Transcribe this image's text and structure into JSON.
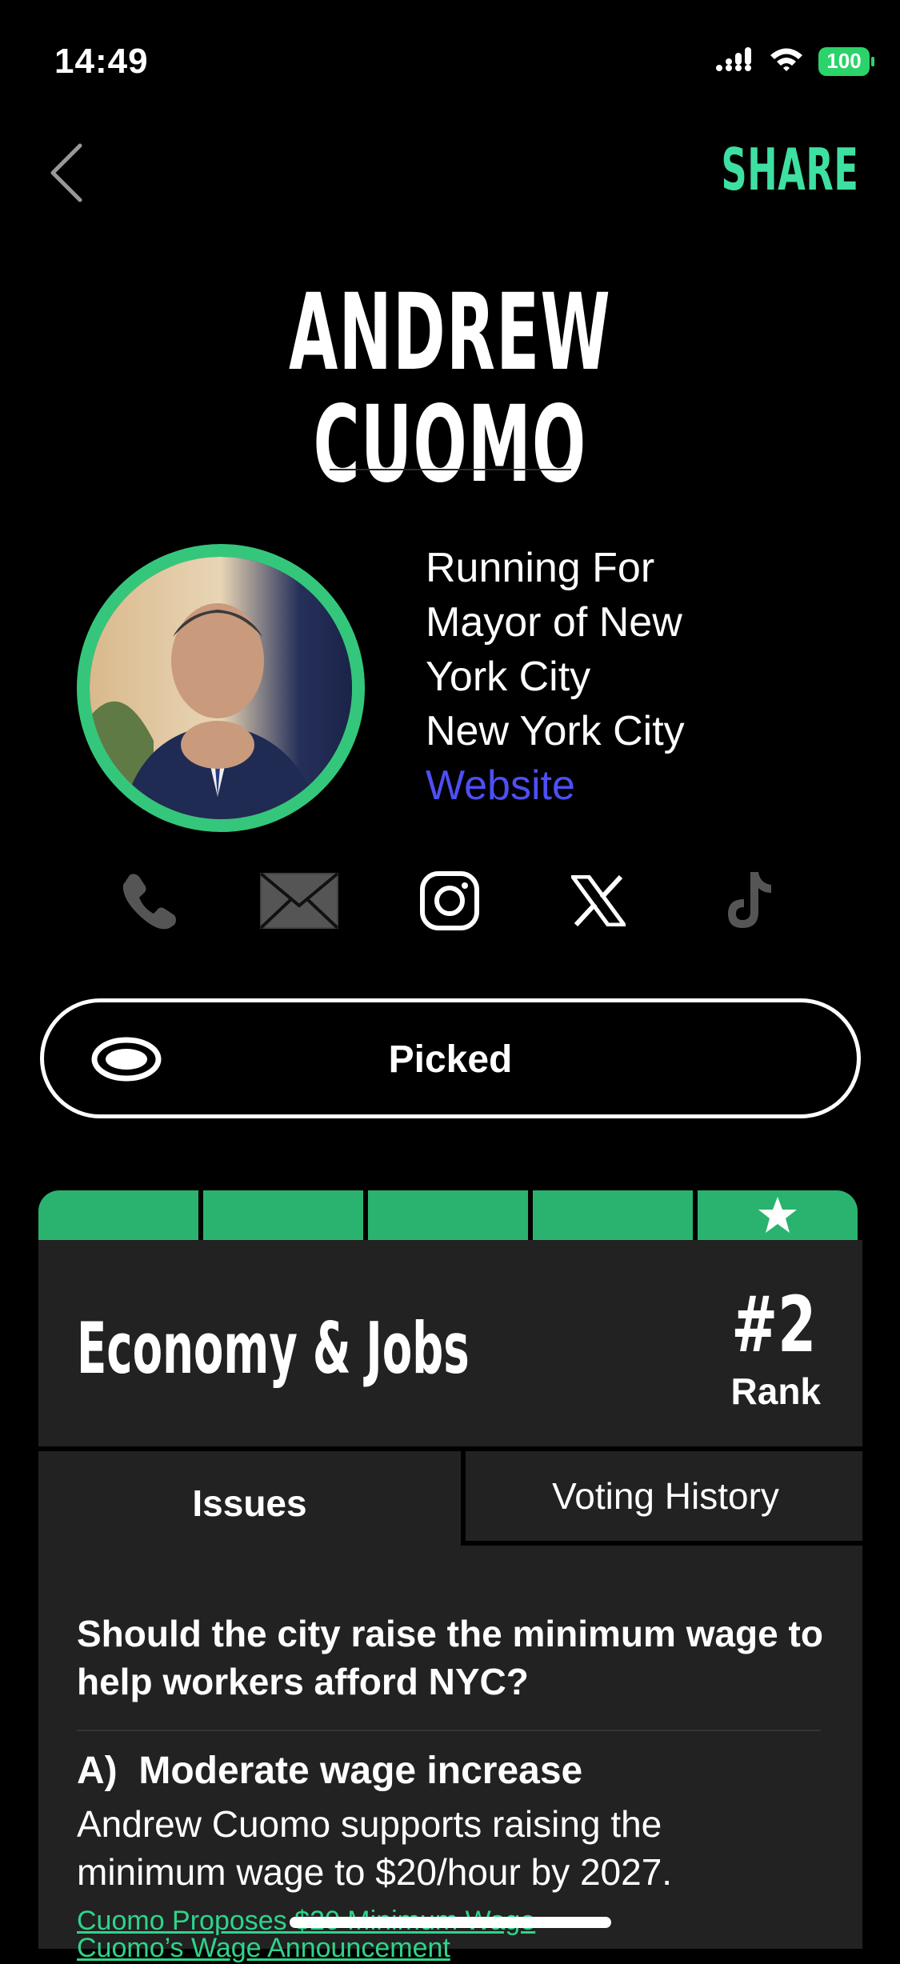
{
  "status_bar": {
    "time": "14:49",
    "battery": "100",
    "icons": [
      "signal-icon",
      "wifi-icon",
      "battery-icon"
    ]
  },
  "header": {
    "back_icon": "chevron-left-icon",
    "share_label": "SHARE",
    "accent_color": "#3ee0a1"
  },
  "candidate": {
    "name": "ANDREW CUOMO",
    "running_for_lines": [
      "Running For",
      "Mayor of New",
      "York City"
    ],
    "location": "New York City",
    "website_label": "Website",
    "ring_color": "#34c77b"
  },
  "social": [
    "phone-icon",
    "mail-icon",
    "instagram-icon",
    "x-icon",
    "tiktok-icon"
  ],
  "pick": {
    "label": "Picked"
  },
  "rating": {
    "segments": 5,
    "star_segment": 5,
    "color": "#2ab36f"
  },
  "card": {
    "title": "Economy & Jobs",
    "rank_number": "#2",
    "rank_label": "Rank",
    "tabs": [
      {
        "label": "Issues",
        "active": true
      },
      {
        "label": "Voting History",
        "active": false
      }
    ],
    "question": "Should the city raise the minimum wage to help workers afford NYC?",
    "answer_letter": "A)",
    "answer_title": "Moderate wage increase",
    "answer_text": "Andrew Cuomo supports raising the minimum wage to $20/hour by 2027.",
    "sources": [
      "Cuomo Proposes $20 Minimum Wage",
      "Cuomo’s Wage Announcement"
    ]
  }
}
